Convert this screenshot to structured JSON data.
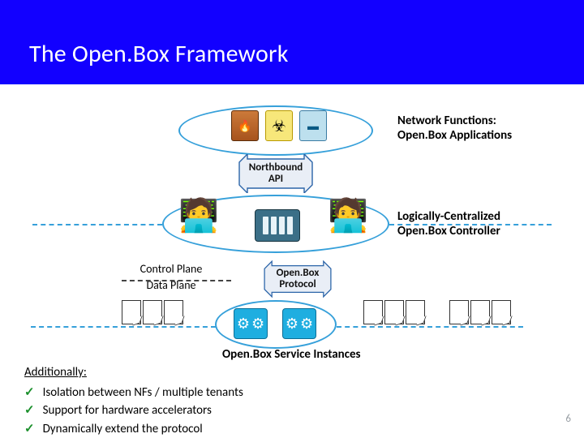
{
  "title": "The Open.Box Framework",
  "layers": {
    "network_functions": {
      "line1": "Network Functions:",
      "line2": "Open.Box Applications"
    },
    "northbound": {
      "line1": "Northbound",
      "line2": "API"
    },
    "controller": {
      "line1": "Logically-Centralized",
      "line2": "Open.Box Controller"
    },
    "planes": {
      "control": "Control Plane",
      "data": "Data Plane"
    },
    "protocol": {
      "line1": "Open.Box",
      "line2": "Protocol"
    },
    "service_instances": "Open.Box Service Instances"
  },
  "icons": {
    "firewall": "firewall-icon",
    "biohazard": "biohazard-icon",
    "server": "server-icon",
    "person": "person-icon",
    "controller_box": "controller-box-icon",
    "gear": "gear-icon",
    "page": "page-icon"
  },
  "additional": {
    "heading": "Additionally:",
    "items": [
      "Isolation between NFs / multiple tenants",
      "Support for hardware accelerators",
      "Dynamically extend the protocol"
    ]
  },
  "page_number": "6",
  "colors": {
    "title_bg": "#1200ff",
    "accent": "#36a0da"
  }
}
